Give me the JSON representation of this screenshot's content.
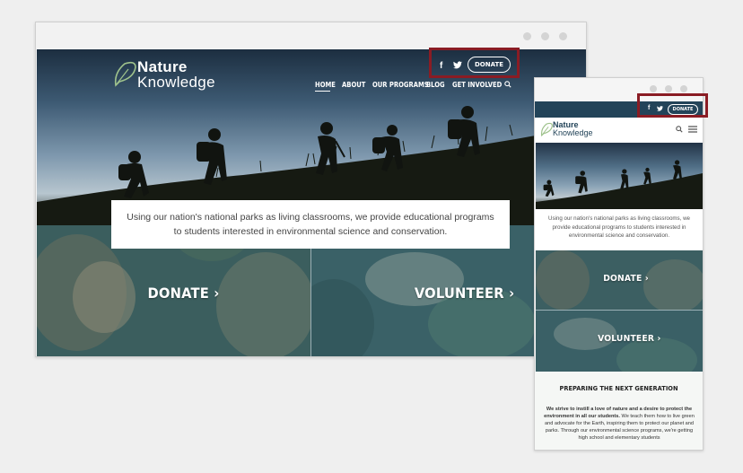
{
  "brand": {
    "line1": "Nature",
    "line2": "Knowledge",
    "leaf_color": "#9fc28c"
  },
  "social": {
    "facebook": "f",
    "twitter": "🐦"
  },
  "donate_button": "DONATE",
  "nav": {
    "items": [
      "HOME",
      "ABOUT",
      "OUR PROGRAMS",
      "BLOG",
      "GET INVOLVED"
    ],
    "active": "HOME"
  },
  "intro": "Using our nation's national parks as living classrooms, we provide educational programs to students interested in environmental science and conservation.",
  "intro_mobile": "Using our nation's national parks as living classrooms, we provide educational programs to students interested in environmental science and conservation.",
  "cta": {
    "donate": "DONATE ›",
    "volunteer": "VOLUNTEER ›"
  },
  "section": {
    "heading": "PREPARING THE NEXT GENERATION",
    "body_bold": "We strive to instill a love of nature and a desire to protect the environment in all our students.",
    "body_rest": " We teach them how to live green and advocate for the Earth, inspiring them to protect our planet and parks. Through our environmental science programs, we're getting high school and elementary students"
  },
  "colors": {
    "highlight": "#8a1c24",
    "navy": "#234459",
    "teal_overlay": "#2e5a6a"
  }
}
